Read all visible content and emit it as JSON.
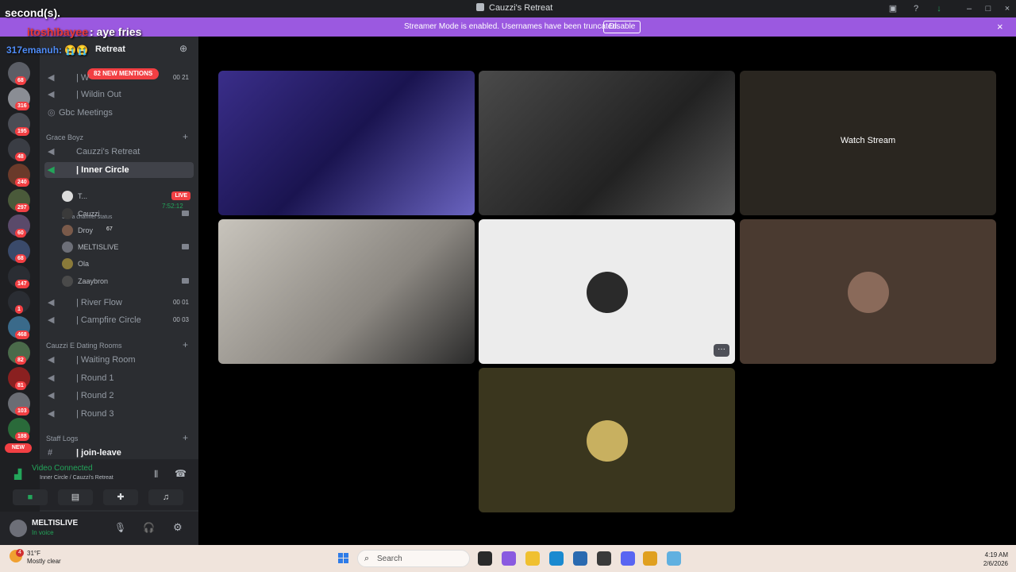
{
  "window": {
    "title": "Cauzzi's Retreat"
  },
  "banner": {
    "message": "Streamer Mode is enabled. Usernames have been truncated.",
    "disable_label": "Disable",
    "close_icon": "×"
  },
  "overlay": {
    "line1": "second(s).",
    "chat_name": "itoshibayee",
    "chat_msg": ": aye fries",
    "line3": "317emanuh: 😭😭"
  },
  "rail": {
    "badges": [
      "NEW",
      "68",
      "316",
      "195",
      "48",
      "240",
      "297",
      "60",
      "68",
      "147",
      "1",
      "468",
      "82",
      "81",
      "103",
      "188",
      "NEW"
    ]
  },
  "sidebar": {
    "server_name": "Retreat",
    "mentions": "82 NEW MENTIONS",
    "top_channels": [
      {
        "label": "| W",
        "count": "00 21"
      },
      {
        "label": "| Wildin Out",
        "count": ""
      },
      {
        "label": "Gbc Meetings",
        "count": ""
      }
    ],
    "cat1": "Grace Boyz",
    "cat1_channels": [
      {
        "label": "Cauzzi's Retreat"
      },
      {
        "label": "| Inner Circle",
        "timer": "7:52:12"
      }
    ],
    "status": "Set a channel status",
    "live": "LIVE",
    "voice_users": [
      "T...",
      "Cauzzi",
      "Droy",
      "MELTISLIVE",
      "Ola",
      "Zaaybron"
    ],
    "droy_badge": "67",
    "cat1_more": [
      {
        "label": "| River Flow",
        "count": "00 01"
      },
      {
        "label": "| Campfire Circle",
        "count": "00 03"
      }
    ],
    "cat2": "Cauzzi E Dating Rooms",
    "cat2_channels": [
      "| Waiting Room",
      "| Round 1",
      "| Round 2",
      "| Round 3"
    ],
    "cat3": "Staff Logs",
    "cat3_channels": [
      "| join-leave"
    ]
  },
  "voice": {
    "connected": "Video Connected",
    "location": "Inner Circle / Cauzzi's Retreat"
  },
  "user_panel": {
    "name": "MELTISLIVE",
    "status": "In voice"
  },
  "tiles": {
    "watch_stream": "Watch Stream",
    "more_icon": "···"
  },
  "taskbar": {
    "temp": "31°F",
    "condition": "Mostly clear",
    "weather_badge": "4",
    "search": "Search",
    "time": "4:19 AM",
    "date": "2/6/2026"
  },
  "colors": {
    "banner": "#9b59e0",
    "accent_green": "#23a55a",
    "badge_red": "#f23f43"
  }
}
